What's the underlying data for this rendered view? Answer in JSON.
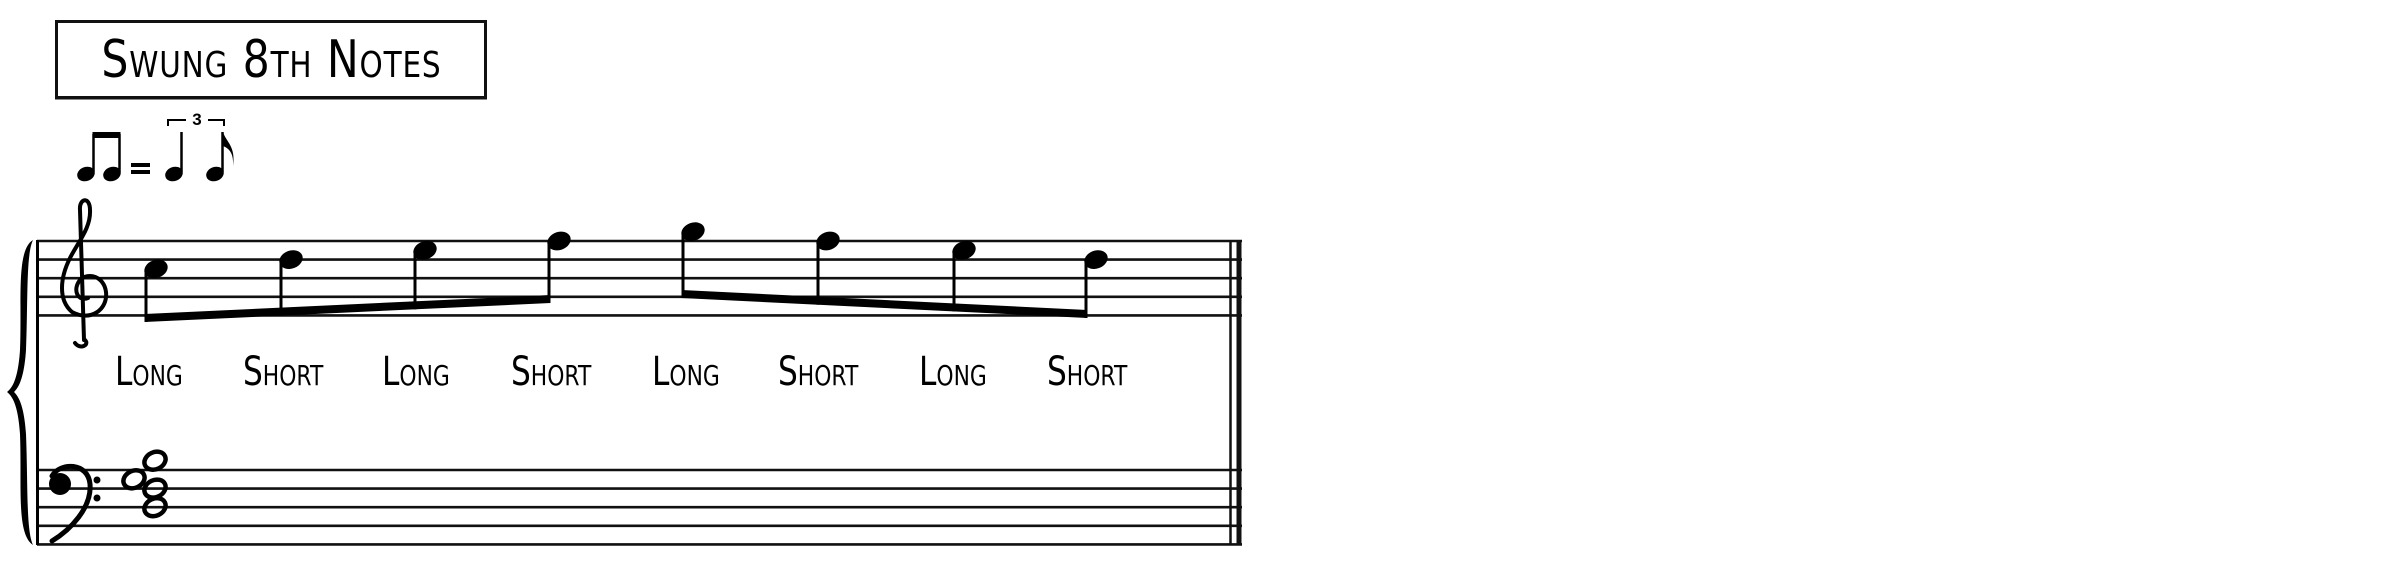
{
  "title": "Swung 8th Notes",
  "swing_marking": {
    "lhs": "two-beamed-eighth-notes",
    "equals": "=",
    "rhs": "triplet-quarter-eighth",
    "tuplet_number": "3"
  },
  "system": {
    "staves": [
      {
        "clef": "treble-clef",
        "role": "upper"
      },
      {
        "clef": "bass-clef",
        "role": "lower"
      }
    ],
    "brace": "grand-staff-brace",
    "final_barline": "final-double-barline"
  },
  "treble_notes": [
    {
      "pitch": "C5",
      "duration": "eighth",
      "beam_group": 1
    },
    {
      "pitch": "D5",
      "duration": "eighth",
      "beam_group": 1
    },
    {
      "pitch": "E5",
      "duration": "eighth",
      "beam_group": 1
    },
    {
      "pitch": "F5",
      "duration": "eighth",
      "beam_group": 1
    },
    {
      "pitch": "G5",
      "duration": "eighth",
      "beam_group": 2
    },
    {
      "pitch": "F5",
      "duration": "eighth",
      "beam_group": 2
    },
    {
      "pitch": "E5",
      "duration": "eighth",
      "beam_group": 2
    },
    {
      "pitch": "D5",
      "duration": "eighth",
      "beam_group": 2
    }
  ],
  "bass_chord": {
    "duration": "whole",
    "pitches": [
      "D3",
      "F3",
      "G3",
      "B3"
    ]
  },
  "labels": [
    "Long",
    "Short",
    "Long",
    "Short",
    "Long",
    "Short",
    "Long",
    "Short"
  ]
}
